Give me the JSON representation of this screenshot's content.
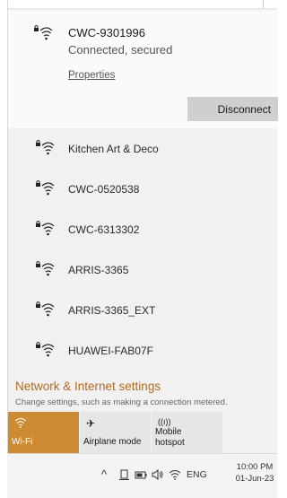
{
  "connected": {
    "name": "CWC-9301996",
    "status": "Connected, secured",
    "properties_label": "Properties",
    "disconnect_label": "Disconnect"
  },
  "networks": [
    {
      "name": "Kitchen Art & Deco"
    },
    {
      "name": "CWC-0520538"
    },
    {
      "name": "CWC-6313302"
    },
    {
      "name": "ARRIS-3365"
    },
    {
      "name": "ARRIS-3365_EXT"
    },
    {
      "name": "HUAWEI-FAB07F"
    }
  ],
  "settings": {
    "title": "Network & Internet settings",
    "description": "Change settings, such as making a connection metered."
  },
  "tiles": {
    "wifi": {
      "label": "Wi-Fi",
      "icon": "wifi-icon",
      "active": true
    },
    "airplane": {
      "label": "Airplane mode",
      "icon": "airplane-icon",
      "glyph": "✈"
    },
    "hotspot": {
      "label_line1": "Mobile",
      "label_line2": "hotspot",
      "icon": "hotspot-icon",
      "glyph": "((ı))"
    }
  },
  "taskbar": {
    "chevron": "^",
    "language": "ENG",
    "time": "10:00 PM",
    "date": "01-Jun-23"
  },
  "colors": {
    "accent": "#cf8a34",
    "link": "#b36a1e",
    "flyout_bg": "#f1f1f1"
  }
}
